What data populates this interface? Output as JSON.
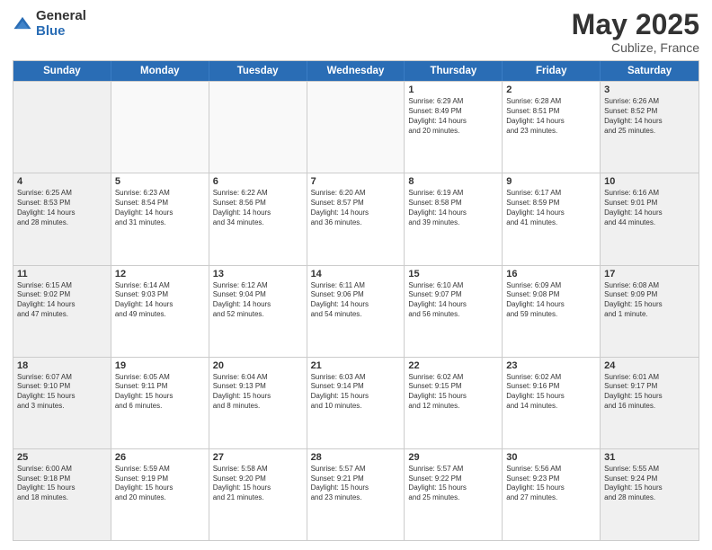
{
  "logo": {
    "general": "General",
    "blue": "Blue"
  },
  "title": {
    "month": "May 2025",
    "location": "Cublize, France"
  },
  "header": {
    "days": [
      "Sunday",
      "Monday",
      "Tuesday",
      "Wednesday",
      "Thursday",
      "Friday",
      "Saturday"
    ]
  },
  "rows": [
    [
      {
        "day": "",
        "info": ""
      },
      {
        "day": "",
        "info": ""
      },
      {
        "day": "",
        "info": ""
      },
      {
        "day": "",
        "info": ""
      },
      {
        "day": "1",
        "info": "Sunrise: 6:29 AM\nSunset: 8:49 PM\nDaylight: 14 hours\nand 20 minutes."
      },
      {
        "day": "2",
        "info": "Sunrise: 6:28 AM\nSunset: 8:51 PM\nDaylight: 14 hours\nand 23 minutes."
      },
      {
        "day": "3",
        "info": "Sunrise: 6:26 AM\nSunset: 8:52 PM\nDaylight: 14 hours\nand 25 minutes."
      }
    ],
    [
      {
        "day": "4",
        "info": "Sunrise: 6:25 AM\nSunset: 8:53 PM\nDaylight: 14 hours\nand 28 minutes."
      },
      {
        "day": "5",
        "info": "Sunrise: 6:23 AM\nSunset: 8:54 PM\nDaylight: 14 hours\nand 31 minutes."
      },
      {
        "day": "6",
        "info": "Sunrise: 6:22 AM\nSunset: 8:56 PM\nDaylight: 14 hours\nand 34 minutes."
      },
      {
        "day": "7",
        "info": "Sunrise: 6:20 AM\nSunset: 8:57 PM\nDaylight: 14 hours\nand 36 minutes."
      },
      {
        "day": "8",
        "info": "Sunrise: 6:19 AM\nSunset: 8:58 PM\nDaylight: 14 hours\nand 39 minutes."
      },
      {
        "day": "9",
        "info": "Sunrise: 6:17 AM\nSunset: 8:59 PM\nDaylight: 14 hours\nand 41 minutes."
      },
      {
        "day": "10",
        "info": "Sunrise: 6:16 AM\nSunset: 9:01 PM\nDaylight: 14 hours\nand 44 minutes."
      }
    ],
    [
      {
        "day": "11",
        "info": "Sunrise: 6:15 AM\nSunset: 9:02 PM\nDaylight: 14 hours\nand 47 minutes."
      },
      {
        "day": "12",
        "info": "Sunrise: 6:14 AM\nSunset: 9:03 PM\nDaylight: 14 hours\nand 49 minutes."
      },
      {
        "day": "13",
        "info": "Sunrise: 6:12 AM\nSunset: 9:04 PM\nDaylight: 14 hours\nand 52 minutes."
      },
      {
        "day": "14",
        "info": "Sunrise: 6:11 AM\nSunset: 9:06 PM\nDaylight: 14 hours\nand 54 minutes."
      },
      {
        "day": "15",
        "info": "Sunrise: 6:10 AM\nSunset: 9:07 PM\nDaylight: 14 hours\nand 56 minutes."
      },
      {
        "day": "16",
        "info": "Sunrise: 6:09 AM\nSunset: 9:08 PM\nDaylight: 14 hours\nand 59 minutes."
      },
      {
        "day": "17",
        "info": "Sunrise: 6:08 AM\nSunset: 9:09 PM\nDaylight: 15 hours\nand 1 minute."
      }
    ],
    [
      {
        "day": "18",
        "info": "Sunrise: 6:07 AM\nSunset: 9:10 PM\nDaylight: 15 hours\nand 3 minutes."
      },
      {
        "day": "19",
        "info": "Sunrise: 6:05 AM\nSunset: 9:11 PM\nDaylight: 15 hours\nand 6 minutes."
      },
      {
        "day": "20",
        "info": "Sunrise: 6:04 AM\nSunset: 9:13 PM\nDaylight: 15 hours\nand 8 minutes."
      },
      {
        "day": "21",
        "info": "Sunrise: 6:03 AM\nSunset: 9:14 PM\nDaylight: 15 hours\nand 10 minutes."
      },
      {
        "day": "22",
        "info": "Sunrise: 6:02 AM\nSunset: 9:15 PM\nDaylight: 15 hours\nand 12 minutes."
      },
      {
        "day": "23",
        "info": "Sunrise: 6:02 AM\nSunset: 9:16 PM\nDaylight: 15 hours\nand 14 minutes."
      },
      {
        "day": "24",
        "info": "Sunrise: 6:01 AM\nSunset: 9:17 PM\nDaylight: 15 hours\nand 16 minutes."
      }
    ],
    [
      {
        "day": "25",
        "info": "Sunrise: 6:00 AM\nSunset: 9:18 PM\nDaylight: 15 hours\nand 18 minutes."
      },
      {
        "day": "26",
        "info": "Sunrise: 5:59 AM\nSunset: 9:19 PM\nDaylight: 15 hours\nand 20 minutes."
      },
      {
        "day": "27",
        "info": "Sunrise: 5:58 AM\nSunset: 9:20 PM\nDaylight: 15 hours\nand 21 minutes."
      },
      {
        "day": "28",
        "info": "Sunrise: 5:57 AM\nSunset: 9:21 PM\nDaylight: 15 hours\nand 23 minutes."
      },
      {
        "day": "29",
        "info": "Sunrise: 5:57 AM\nSunset: 9:22 PM\nDaylight: 15 hours\nand 25 minutes."
      },
      {
        "day": "30",
        "info": "Sunrise: 5:56 AM\nSunset: 9:23 PM\nDaylight: 15 hours\nand 27 minutes."
      },
      {
        "day": "31",
        "info": "Sunrise: 5:55 AM\nSunset: 9:24 PM\nDaylight: 15 hours\nand 28 minutes."
      }
    ]
  ]
}
